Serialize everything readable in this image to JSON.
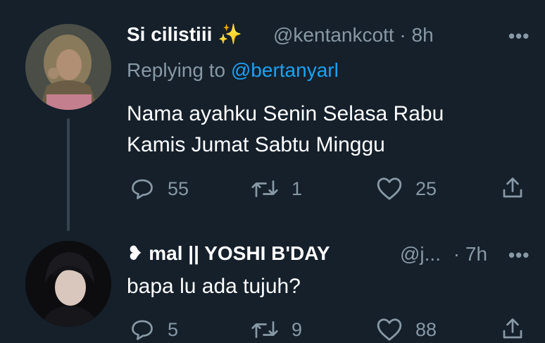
{
  "tweets": [
    {
      "name": "Si cilistiii",
      "name_emoji": "✨",
      "handle": "@kentankcott",
      "separator": "·",
      "time": "8h",
      "more_label": "•••",
      "replying_prefix": "Replying to",
      "replying_to": "@bertanyarl",
      "text_line1": "Nama ayahku Senin Selasa Rabu",
      "text_line2": "Kamis Jumat Sabtu Minggu",
      "replies": "55",
      "retweets": "1",
      "likes": "25"
    },
    {
      "prefix_emoji": "❥",
      "name": "mal || YOSHI B'DAY",
      "handle": "@j...",
      "separator": "·",
      "time": "7h",
      "more_label": "•••",
      "text": "bapa lu ada tujuh?",
      "replies": "5",
      "retweets": "9",
      "likes": "88"
    }
  ],
  "colors": {
    "background": "#15202b",
    "primary_text": "#ffffff",
    "secondary_text": "#8899a6",
    "link": "#1da1f2",
    "thread_line": "#38444d"
  }
}
